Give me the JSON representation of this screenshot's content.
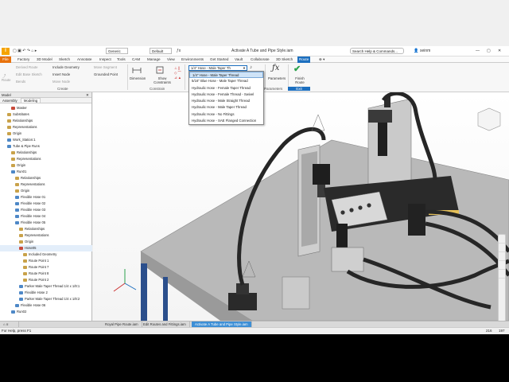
{
  "title_bar": {
    "product": "I",
    "material": "Generic",
    "appearance": "Default",
    "document_title": "Activate A Tube and Pipe Style.iam",
    "search_placeholder": "Search Help & Commands...",
    "user": "seinm"
  },
  "tabs": [
    "File",
    "Factory",
    "3D Model",
    "Sketch",
    "Annotate",
    "Inspect",
    "Tools",
    "CAM",
    "Manage",
    "View",
    "Environments",
    "Get Started",
    "Vault",
    "Collaborate",
    "3D Sketch",
    "Route"
  ],
  "active_tab": "Route",
  "ribbon": {
    "create": {
      "label": "Create",
      "items": [
        "Derived Route",
        "Edit Base Sketch",
        "Bends",
        "Include Geometry",
        "Insert Node",
        "Move Node",
        "Move Segment",
        "Grounded Point"
      ]
    },
    "constrain": {
      "label": "Constrain",
      "items": [
        "Dimension",
        "Show Constraints"
      ]
    },
    "style_selector": "1/4\" Hose - Male Taper Th",
    "parameters_label": "Parameters",
    "parameters_item": "Parameters",
    "exit_label": "Exit",
    "finish_route": "Finish Route"
  },
  "style_dropdown": {
    "options": [
      "1/4\" Hose - Male Taper Thread",
      "5/16\" Blue Hose - Male Taper Thread",
      "Hydraulic Hose - Female Taper Thread",
      "Hydraulic Hose - Female Thread - Swivel",
      "Hydraulic Hose - Male Straight Thread",
      "Hydraulic Hose - Male Taper Thread",
      "Hydraulic Hose - No Fittings",
      "Hydraulic Hose - SAE Flanged Connection"
    ],
    "selected_index": 0
  },
  "browser": {
    "header": "Model",
    "tabs": [
      "Assembly",
      "Modeling"
    ],
    "nodes": [
      {
        "label": "Master",
        "depth": 2,
        "icon": "red"
      },
      {
        "label": "Substitutes",
        "depth": 1,
        "icon": "yellow"
      },
      {
        "label": "Relationships",
        "depth": 1,
        "icon": "yellow"
      },
      {
        "label": "Representations",
        "depth": 1,
        "icon": "yellow"
      },
      {
        "label": "Origin",
        "depth": 1,
        "icon": "yellow"
      },
      {
        "label": "Work_Station:1",
        "depth": 1,
        "icon": "blue"
      },
      {
        "label": "Tube & Pipe Runs",
        "depth": 1,
        "icon": "blue"
      },
      {
        "label": "Relationships",
        "depth": 2,
        "icon": "yellow"
      },
      {
        "label": "Representations",
        "depth": 2,
        "icon": "yellow"
      },
      {
        "label": "Origin",
        "depth": 2,
        "icon": "yellow"
      },
      {
        "label": "Run01",
        "depth": 2,
        "icon": "blue"
      },
      {
        "label": "Relationships",
        "depth": 3,
        "icon": "yellow"
      },
      {
        "label": "Representations",
        "depth": 3,
        "icon": "yellow"
      },
      {
        "label": "Origin",
        "depth": 3,
        "icon": "yellow"
      },
      {
        "label": "Flexible Hose 01",
        "depth": 3,
        "icon": "blue"
      },
      {
        "label": "Flexible Hose 02",
        "depth": 3,
        "icon": "blue"
      },
      {
        "label": "Flexible Hose 03",
        "depth": 3,
        "icon": "blue"
      },
      {
        "label": "Flexible Hose 04",
        "depth": 3,
        "icon": "blue"
      },
      {
        "label": "Flexible Hose 05",
        "depth": 3,
        "icon": "blue"
      },
      {
        "label": "Relationships",
        "depth": 4,
        "icon": "yellow"
      },
      {
        "label": "Representations",
        "depth": 4,
        "icon": "yellow"
      },
      {
        "label": "Origin",
        "depth": 4,
        "icon": "yellow"
      },
      {
        "label": "Hose05",
        "depth": 4,
        "icon": "red"
      },
      {
        "label": "Included Geometry",
        "depth": 5,
        "icon": "yellow"
      },
      {
        "label": "Route Point 1",
        "depth": 5,
        "icon": "yellow"
      },
      {
        "label": "Route Point 7",
        "depth": 5,
        "icon": "yellow"
      },
      {
        "label": "Route Point 8",
        "depth": 5,
        "icon": "yellow"
      },
      {
        "label": "Route Point 2",
        "depth": 5,
        "icon": "yellow"
      },
      {
        "label": "Parker Male Taper Thread 1/4 x 1/8:1",
        "depth": 4,
        "icon": "blue"
      },
      {
        "label": "Flexible Hose 2",
        "depth": 4,
        "icon": "blue"
      },
      {
        "label": "Parker Male Taper Thread 1/4 x 1/8:2",
        "depth": 4,
        "icon": "blue"
      },
      {
        "label": "Flexible Hose 06",
        "depth": 3,
        "icon": "blue"
      },
      {
        "label": "Run02",
        "depth": 2,
        "icon": "blue"
      }
    ]
  },
  "doc_tabs": [
    "Royal Pipe Route.iam",
    "Edit Routes and Fittings.iam",
    "Activate A Tube and Pipe Style.iam"
  ],
  "active_doc_tab": 2,
  "status": {
    "left": "For Help, press F1",
    "right_a": "216",
    "right_b": "197"
  },
  "colors": {
    "accent": "#1c6fbf",
    "file_tab": "#e8720c",
    "table_top": "#b8b8b8",
    "hose": "#2a2a2a"
  }
}
